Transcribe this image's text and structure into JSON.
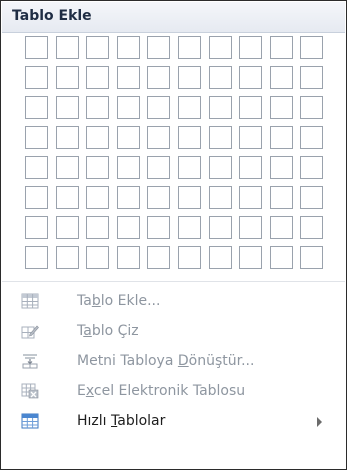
{
  "header": {
    "title": "Tablo Ekle"
  },
  "grid": {
    "columns": 10,
    "rows": 8
  },
  "menu": {
    "items": [
      {
        "pre": "Ta",
        "mn": "b",
        "post": "lo Ekle...",
        "enabled": false,
        "icon": "table-grid-icon"
      },
      {
        "pre": "T",
        "mn": "a",
        "post": "blo Çiz",
        "enabled": false,
        "icon": "draw-table-pencil-icon"
      },
      {
        "pre": "Metni Tabloya ",
        "mn": "D",
        "post": "önüştür...",
        "enabled": false,
        "icon": "text-to-table-icon"
      },
      {
        "pre": "E",
        "mn": "x",
        "post": "cel Elektronik Tablosu",
        "enabled": false,
        "icon": "excel-spreadsheet-icon"
      },
      {
        "pre": "Hızlı ",
        "mn": "T",
        "post": "ablolar",
        "enabled": true,
        "icon": "quick-tables-icon",
        "submenu": true
      }
    ]
  },
  "colors": {
    "disabled_text": "#8e96a0",
    "enabled_text": "#1d1d1d",
    "cell_border": "#9aa2ad",
    "header_bg": "#eaedf2"
  }
}
